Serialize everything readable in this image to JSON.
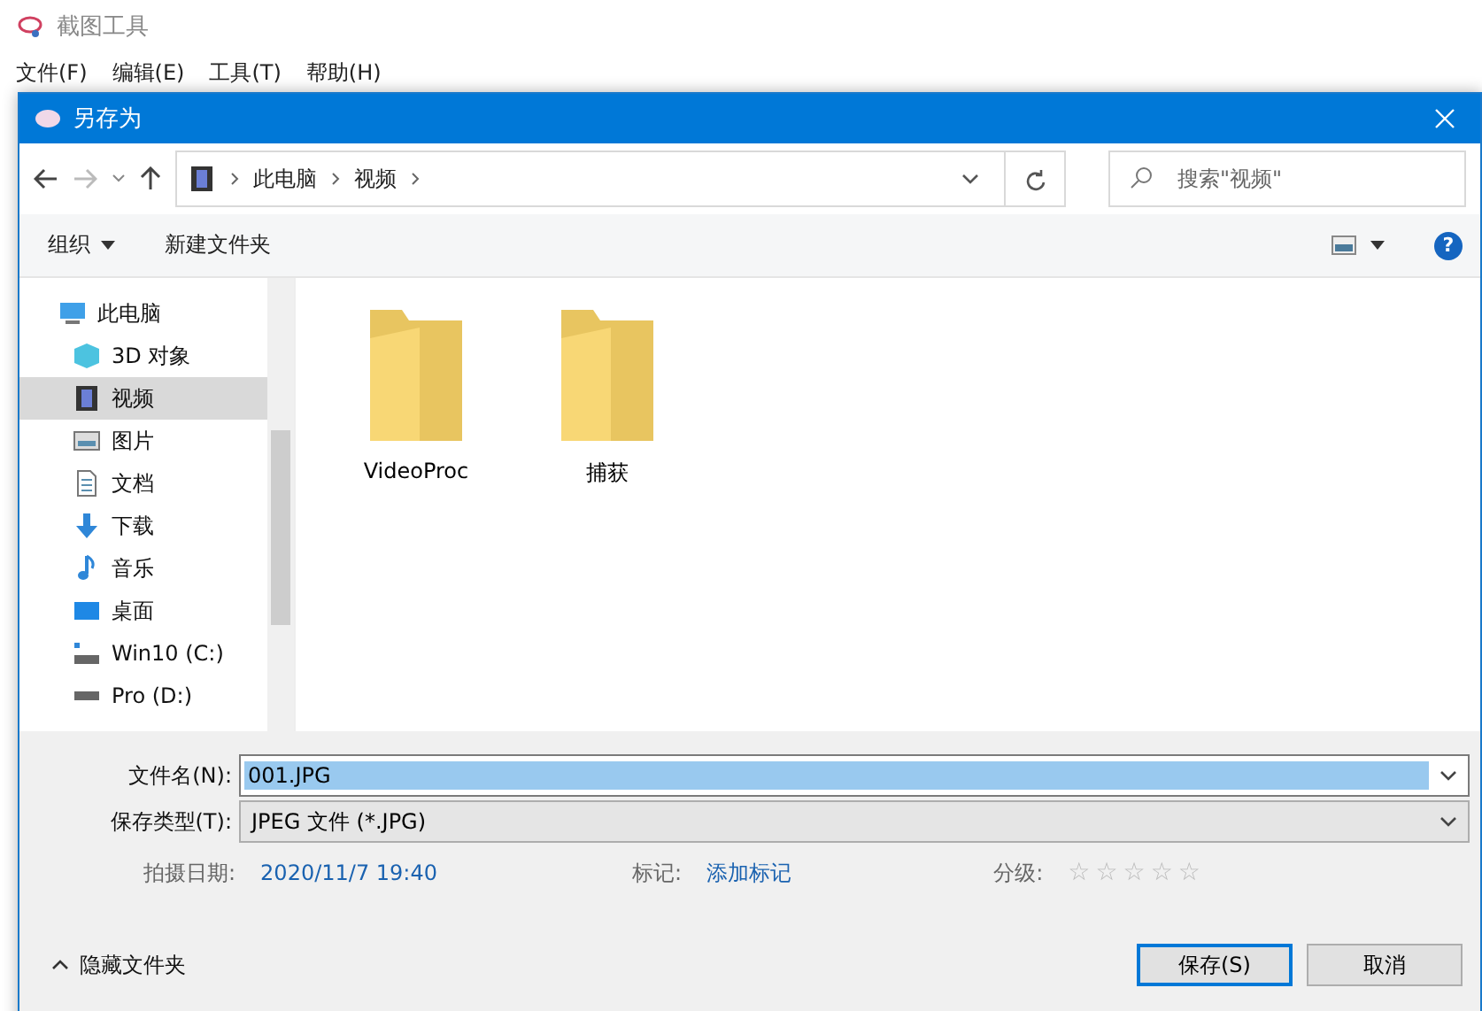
{
  "app": {
    "title": "截图工具",
    "menu": [
      "文件(F)",
      "编辑(E)",
      "工具(T)",
      "帮助(H)"
    ]
  },
  "dialog": {
    "title": "另存为",
    "breadcrumb": [
      "此电脑",
      "视频"
    ],
    "search": {
      "placeholder": "搜索\"视频\""
    },
    "toolbar": {
      "organize": "组织",
      "new_folder": "新建文件夹",
      "help": "?"
    },
    "sidebar": [
      {
        "kind": "pc",
        "label": "此电脑",
        "selected": false
      },
      {
        "kind": "cube",
        "label": "3D 对象",
        "selected": false
      },
      {
        "kind": "film",
        "label": "视频",
        "selected": true
      },
      {
        "kind": "picture",
        "label": "图片",
        "selected": false
      },
      {
        "kind": "doc",
        "label": "文档",
        "selected": false
      },
      {
        "kind": "download",
        "label": "下载",
        "selected": false
      },
      {
        "kind": "music",
        "label": "音乐",
        "selected": false
      },
      {
        "kind": "desktop",
        "label": "桌面",
        "selected": false
      },
      {
        "kind": "drive-win",
        "label": "Win10 (C:)",
        "selected": false
      },
      {
        "kind": "drive",
        "label": "Pro (D:)",
        "selected": false
      }
    ],
    "folders": [
      "VideoProc",
      "捕获"
    ],
    "file_name": {
      "label": "文件名(N):",
      "value": "001.JPG"
    },
    "file_type": {
      "label": "保存类型(T):",
      "value": "JPEG 文件 (*.JPG)"
    },
    "meta": {
      "date_label": "拍摄日期:",
      "date": "2020/11/7 19:40",
      "tags_label": "标记:",
      "tags": "添加标记",
      "rating_label": "分级:",
      "stars": 0
    },
    "hide_folders": "隐藏文件夹",
    "buttons": [
      {
        "label": "保存(S)",
        "kind": "primary"
      },
      {
        "label": "取消",
        "kind": "normal"
      }
    ]
  }
}
